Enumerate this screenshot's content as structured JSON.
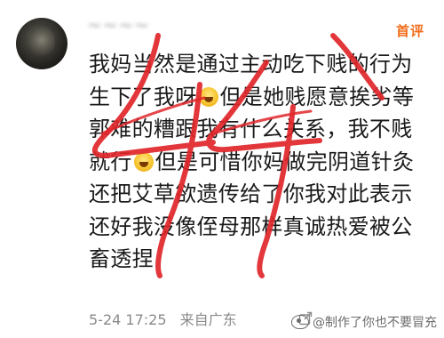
{
  "header": {
    "username": "~~~~",
    "badge": "首评"
  },
  "comment": {
    "lines": [
      {
        "text": "我妈当然是通过主动吃下贱的行为"
      },
      {
        "text_a": "生下了我呀",
        "emoji": "laugh-cry-emoji",
        "text_b": "但是她贱愿意挨劣等"
      },
      {
        "text": "郭难的糟跟我有什么关系，我不贱"
      },
      {
        "text_a": "就行",
        "emoji": "laugh-emoji",
        "text_b": "但是可惜你妈做完阴道针灸"
      },
      {
        "text": "还把艾草欲遗传给了你我对此表示"
      },
      {
        "text": "还好我没像侄母那样真诚热爱被公"
      },
      {
        "text": "畜透捏"
      }
    ]
  },
  "meta": {
    "date": "5-24 17:25",
    "location": "来自广东"
  },
  "watermark": {
    "text": "@制作了你也不要冒充"
  },
  "overlay": {
    "color": "#e0262a"
  }
}
